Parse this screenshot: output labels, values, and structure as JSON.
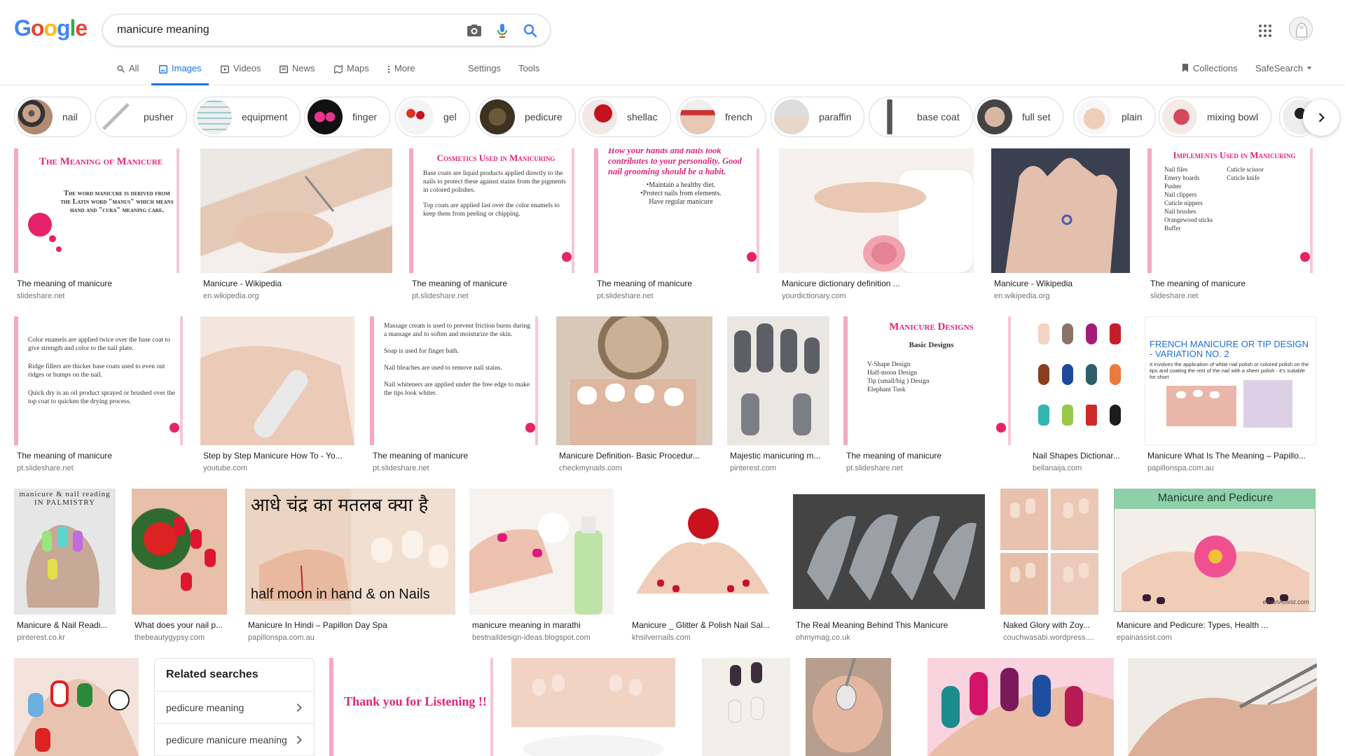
{
  "logo": [
    "G",
    "o",
    "o",
    "g",
    "l",
    "e"
  ],
  "search": {
    "query": "manicure meaning"
  },
  "nav": {
    "tabs": [
      {
        "label": "All"
      },
      {
        "label": "Images"
      },
      {
        "label": "Videos"
      },
      {
        "label": "News"
      },
      {
        "label": "Maps"
      },
      {
        "label": "More"
      }
    ],
    "settings": "Settings",
    "tools": "Tools",
    "collections": "Collections",
    "safesearch": "SafeSearch"
  },
  "chips": [
    {
      "label": "nail"
    },
    {
      "label": "pusher"
    },
    {
      "label": "equipment"
    },
    {
      "label": "finger"
    },
    {
      "label": "gel"
    },
    {
      "label": "pedicure"
    },
    {
      "label": "shellac"
    },
    {
      "label": "french"
    },
    {
      "label": "paraffin"
    },
    {
      "label": "base coat"
    },
    {
      "label": "full set"
    },
    {
      "label": "plain"
    },
    {
      "label": "mixing bowl"
    }
  ],
  "results": {
    "row1": [
      {
        "title": "The meaning of manicure",
        "source": "slideshare.net"
      },
      {
        "title": "Manicure - Wikipedia",
        "source": "en.wikipedia.org"
      },
      {
        "title": "The meaning of manicure",
        "source": "pt.slideshare.net"
      },
      {
        "title": "The meaning of manicure",
        "source": "pt.slideshare.net"
      },
      {
        "title": "Manicure dictionary definition ...",
        "source": "yourdictionary.com"
      },
      {
        "title": "Manicure - Wikipedia",
        "source": "en.wikipedia.org"
      },
      {
        "title": "The meaning of manicure",
        "source": "slideshare.net"
      }
    ],
    "row2": [
      {
        "title": "The meaning of manicure",
        "source": "pt.slideshare.net"
      },
      {
        "title": "Step by Step Manicure How To - Yo...",
        "source": "youtube.com"
      },
      {
        "title": "The meaning of manicure",
        "source": "pt.slideshare.net"
      },
      {
        "title": "Manicure Definition- Basic Procedur...",
        "source": "checkmynails.com"
      },
      {
        "title": "Majestic manicuring m...",
        "source": "pinterest.com"
      },
      {
        "title": "The meaning of manicure",
        "source": "pt.slideshare.net"
      },
      {
        "title": "Nail Shapes Dictionar...",
        "source": "bellanaija.com"
      },
      {
        "title": "Manicure What Is The Meaning – Papillo...",
        "source": "papillonspa.com.au"
      }
    ],
    "row3": [
      {
        "title": "Manicure & Nail Readi...",
        "source": "pinterest.co.kr"
      },
      {
        "title": "What does your nail p...",
        "source": "thebeautygypsy.com"
      },
      {
        "title": "Manicure In Hindi – Papillon Day Spa",
        "source": "papillonspa.com.au"
      },
      {
        "title": "manicure meaning in marathi",
        "source": "bestnaildesign-ideas.blogspot.com"
      },
      {
        "title": "Manicure _ Glitter & Polish Nail Sal...",
        "source": "khsilvernails.com"
      },
      {
        "title": "The Real Meaning Behind This Manicure",
        "source": "ohmymag.co.uk"
      },
      {
        "title": "Naked Glory with Zoy...",
        "source": "couchwasabi.wordpress...."
      },
      {
        "title": "Manicure and Pedicure: Types, Health ...",
        "source": "epainassist.com"
      }
    ]
  },
  "slides": {
    "s1_head": "The Meaning of Manicure",
    "s1_body": "The word manicure is derived from the Latin word \"manus\" which means hand and \"cura\" meaning care.",
    "s2_head": "Cosmetics Used in Manicuring",
    "s2_b1": "Base coats are liquid products applied directly to the nails to protect these against stains from the pigments in colored polishes.",
    "s2_b2": "Top coats are applied last over the color enamels to keep them from peeling or chipping.",
    "s3_head": "How your hands and nails look contributes to your personality. Good nail grooming should be a habit.",
    "s3_b1": "•Maintain a healthy diet.",
    "s3_b2": "•Protect nails from elements.",
    "s3_b3": "Have regular manicure",
    "s4_head": "Implements Used in Manicuring",
    "s4_col1": [
      "Nail files",
      "Emery boards",
      "Pusher",
      "Nail clippers",
      "Cuticle nippers",
      "Nail brushes",
      "Orangewood sticks",
      "Buffer"
    ],
    "s4_col2": [
      "Cuticle scissor",
      "Cuticle knife"
    ],
    "s5_b1": "Color enamels are applied twice over the base coat to give strength and color to the nail plate.",
    "s5_b2": "Ridge fillers are thicker base coats used to even out ridges or bumps on the nail.",
    "s5_b3": "Quick dry is an oil product sprayed or brushed over the top coat to quicken the drying process.",
    "s6_b1": "Massage cream is used to prevent friction burns during a massage and to soften and moisturize the skin.",
    "s6_b2": "Soap is used for finger bath.",
    "s6_b3": "Nail bleaches are used to remove nail stains.",
    "s6_b4": "Nail whiteners are applied under the free edge to make the tips look whiter.",
    "s7_head": "Manicure Designs",
    "s7_sub": "Basic Designs",
    "s7_list": [
      "V-Shape Design",
      "Half-moon Design",
      "Tip (small/big ) Design",
      "Elephant Tusk"
    ],
    "french_title": "FRENCH MANICURE OR TIP DESIGN - VARIATION NO. 2",
    "french_body": "It involves the application of white nail polish or colored polish on the tips and coating the rest of the nail with a sheer polish - it's suitable for short",
    "palmistry": "manicure & nail reading IN PALMISTRY",
    "hindi_title": "आधे चंद्र का मतलब क्या है",
    "hindi_caption": "half moon in hand & on Nails",
    "mp_title": "Manicure and Pedicure",
    "mp_watermark": "ePainAssist.com",
    "thanks": "Thank you for Listening !!"
  },
  "related": {
    "title": "Related searches",
    "items": [
      {
        "label": "pedicure meaning"
      },
      {
        "label": "pedicure manicure meaning"
      }
    ]
  },
  "colors": {
    "accent": "#1a73e8",
    "slide_pink": "#e0267a",
    "dot_pink": "#e8226a"
  }
}
